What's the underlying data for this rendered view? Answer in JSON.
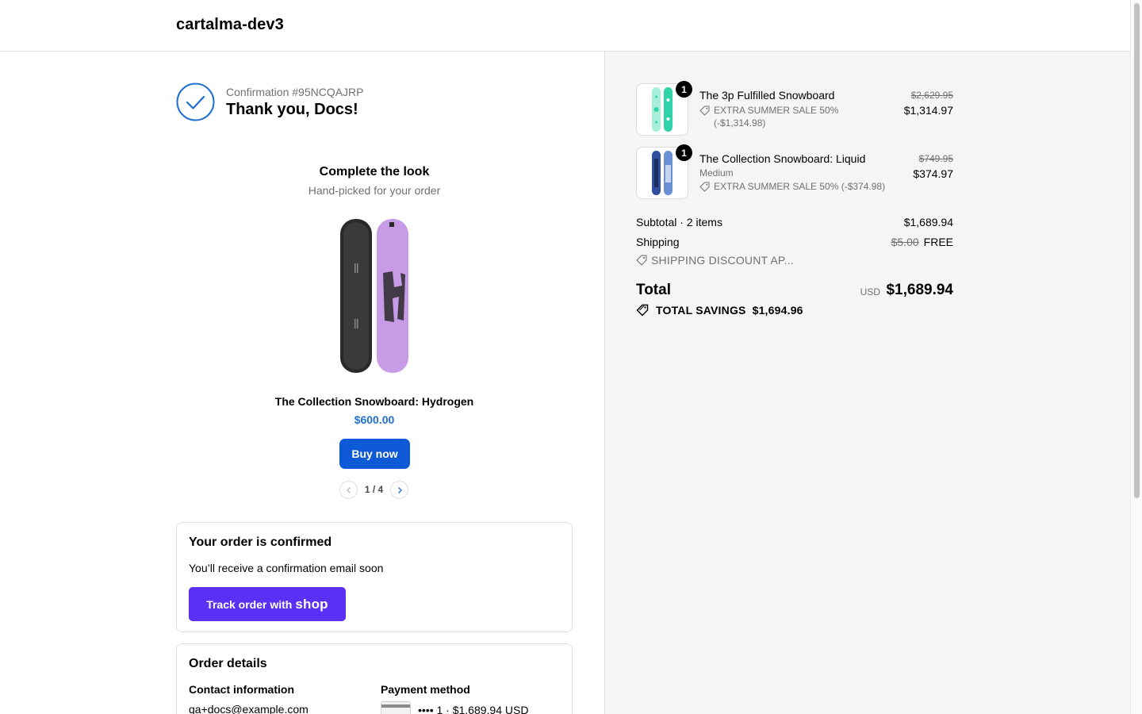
{
  "header": {
    "shop_name": "cartalma-dev3"
  },
  "confirmation": {
    "number": "Confirmation #95NCQAJRP",
    "thank_you": "Thank you, Docs!"
  },
  "upsell": {
    "title": "Complete the look",
    "subtitle": "Hand-picked for your order",
    "product_name": "The Collection Snowboard: Hydrogen",
    "price": "$600.00",
    "buy_label": "Buy now",
    "pager": "1 / 4"
  },
  "order_confirmed": {
    "title": "Your order is confirmed",
    "text": "You’ll receive a confirmation email soon",
    "track_label": "Track order with",
    "track_brand": "shop"
  },
  "order_details": {
    "title": "Order details",
    "contact_label": "Contact information",
    "contact_value": "qa+docs@example.com",
    "payment_label": "Payment method",
    "payment_value": "•••• 1 · $1,689.94 USD"
  },
  "line_items": [
    {
      "quantity": "1",
      "title": "The 3p Fulfilled Snowboard",
      "variant": "",
      "discount": "EXTRA SUMMER SALE 50% (-$1,314.98)",
      "old_price": "$2,629.95",
      "price": "$1,314.97",
      "accent": "#2fd3a7"
    },
    {
      "quantity": "1",
      "title": "The Collection Snowboard: Liquid",
      "variant": "Medium",
      "discount": "EXTRA SUMMER SALE 50% (-$374.98)",
      "old_price": "$749.95",
      "price": "$374.97",
      "accent": "#2f4f9e"
    }
  ],
  "summary": {
    "subtotal_label": "Subtotal · 2 items",
    "subtotal_value": "$1,689.94",
    "shipping_label": "Shipping",
    "shipping_old": "$5.00",
    "shipping_value": "FREE",
    "shipping_discount": "SHIPPING DISCOUNT AP...",
    "total_label": "Total",
    "currency": "USD",
    "total_value": "$1,689.94",
    "savings_label": "TOTAL SAVINGS",
    "savings_value": "$1,694.96"
  },
  "colors": {
    "accent_blue": "#0d59d6",
    "shop_purple": "#5a31f4",
    "check_blue": "#1f6fd1"
  }
}
